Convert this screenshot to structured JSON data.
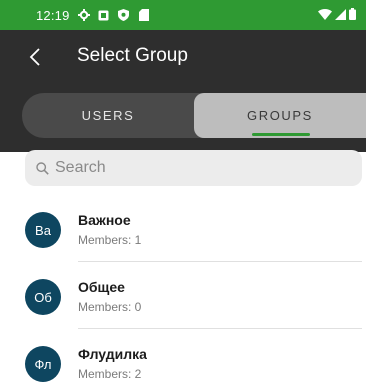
{
  "status_bar": {
    "time": "12:19",
    "icons": [
      "gear-icon",
      "notification-box-icon",
      "shield-icon",
      "sd-card-icon",
      "wifi-icon",
      "cellular-signal-icon",
      "battery-icon"
    ]
  },
  "header": {
    "title": "Select Group",
    "back_icon": "chevron-left-icon"
  },
  "tabs": [
    {
      "label": "USERS",
      "selected": false
    },
    {
      "label": "GROUPS",
      "selected": true
    }
  ],
  "search": {
    "placeholder": "Search",
    "value": ""
  },
  "groups": [
    {
      "initials": "Ва",
      "name": "Важное",
      "members": "Members: 1"
    },
    {
      "initials": "Об",
      "name": "Общее",
      "members": "Members: 0"
    },
    {
      "initials": "Фл",
      "name": "Флудилка",
      "members": "Members: 2"
    }
  ],
  "colors": {
    "status_bar": "#2f9a33",
    "app_bar": "#2e2e2e",
    "accent": "#2f9a33",
    "avatar": "#0e4660"
  }
}
